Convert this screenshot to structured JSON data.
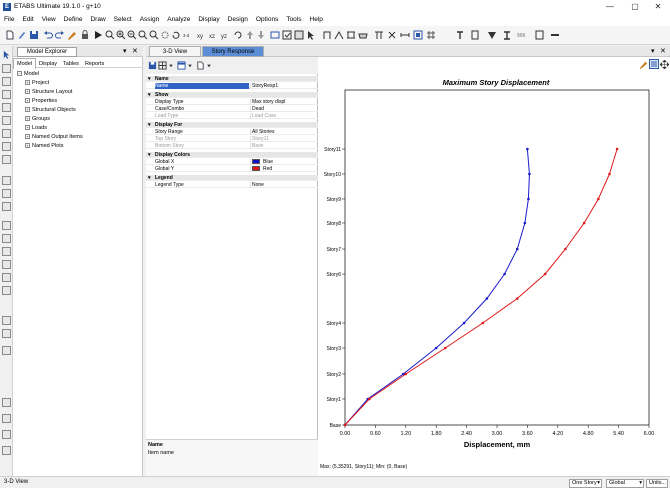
{
  "window": {
    "title": "ETABS Ultimate 19.1.0 - g+10",
    "minimize": "—",
    "maximize": "▢",
    "close": "✕"
  },
  "menu": [
    "File",
    "Edit",
    "View",
    "Define",
    "Draw",
    "Select",
    "Assign",
    "Analyze",
    "Display",
    "Design",
    "Options",
    "Tools",
    "Help"
  ],
  "explorer": {
    "title": "Model Explorer",
    "pin": "▾",
    "close": "✕",
    "tabs": [
      "Model",
      "Display",
      "Tables",
      "Reports"
    ],
    "tree_root": "Model",
    "tree_items": [
      "Project",
      "Structure Layout",
      "Properties",
      "Structural Objects",
      "Groups",
      "Loads",
      "Named Output Items",
      "Named Plots"
    ]
  },
  "doc_tabs": [
    "3-D View",
    "Story Response"
  ],
  "doc_controls": {
    "pin": "▾",
    "close": "✕"
  },
  "props": {
    "name_cat": "Name",
    "name_label": "Name",
    "name_value": "StoryResp1",
    "show_cat": "Show",
    "display_type_label": "Display Type",
    "display_type_value": "Max story displ",
    "case_label": "Case/Combo",
    "case_value": "Dead",
    "load_type_label": "Load Type",
    "load_type_value": "Load Case",
    "display_for_cat": "Display For",
    "story_range_label": "Story Range",
    "story_range_value": "All Stories",
    "top_story_label": "Top Story",
    "top_story_value": "Story11",
    "bottom_story_label": "Bottom Story",
    "bottom_story_value": "Base",
    "colors_cat": "Display Colors",
    "gx_label": "Global X",
    "gx_value": "Blue",
    "gy_label": "Global Y",
    "gy_value": "Red",
    "legend_cat": "Legend",
    "legend_type_label": "Legend Type",
    "legend_type_value": "None",
    "desc_title": "Name",
    "desc_text": "Item name"
  },
  "status": {
    "left": "3-D View",
    "story_mode": "One Story",
    "coord": "Global",
    "units": "Units..."
  },
  "colors": {
    "blue_series": "#1a1acd",
    "red_series": "#e01818",
    "selection": "#2f63c6"
  },
  "chart_data": {
    "type": "line",
    "title": "Maximum Story Displacement",
    "xlabel": "Displacement, mm",
    "ylabel": "",
    "xlim": [
      0,
      6.0
    ],
    "x_ticks": [
      "0.00",
      "0.60",
      "1.20",
      "1.80",
      "2.40",
      "3.00",
      "3.60",
      "4.20",
      "4.80",
      "5.40",
      "6.00"
    ],
    "categories": [
      "Base",
      "Story1",
      "Story2",
      "Story3",
      "Story4",
      "Story6",
      "Story7",
      "Story8",
      "Story9",
      "Story10",
      "Story11"
    ],
    "category_levels": [
      0,
      1,
      2,
      3,
      4,
      6,
      7,
      8,
      9,
      10,
      11
    ],
    "series": [
      {
        "color": "#1a1acd",
        "points": [
          [
            0.0,
            0
          ],
          [
            0.45,
            1
          ],
          [
            1.15,
            2
          ],
          [
            1.8,
            3
          ],
          [
            2.35,
            4
          ],
          [
            2.8,
            5
          ],
          [
            3.15,
            6
          ],
          [
            3.4,
            7
          ],
          [
            3.55,
            8
          ],
          [
            3.62,
            9
          ],
          [
            3.64,
            10
          ],
          [
            3.6,
            11
          ]
        ]
      },
      {
        "color": "#e01818",
        "points": [
          [
            0.0,
            0
          ],
          [
            0.48,
            1
          ],
          [
            1.2,
            2
          ],
          [
            1.98,
            3
          ],
          [
            2.72,
            4
          ],
          [
            3.4,
            5
          ],
          [
            3.95,
            6
          ],
          [
            4.35,
            7
          ],
          [
            4.72,
            8
          ],
          [
            5.0,
            9
          ],
          [
            5.22,
            10
          ],
          [
            5.37,
            11
          ]
        ]
      }
    ],
    "footer": "Max: (5.35291, Story11);  Min: (0, Base)"
  }
}
